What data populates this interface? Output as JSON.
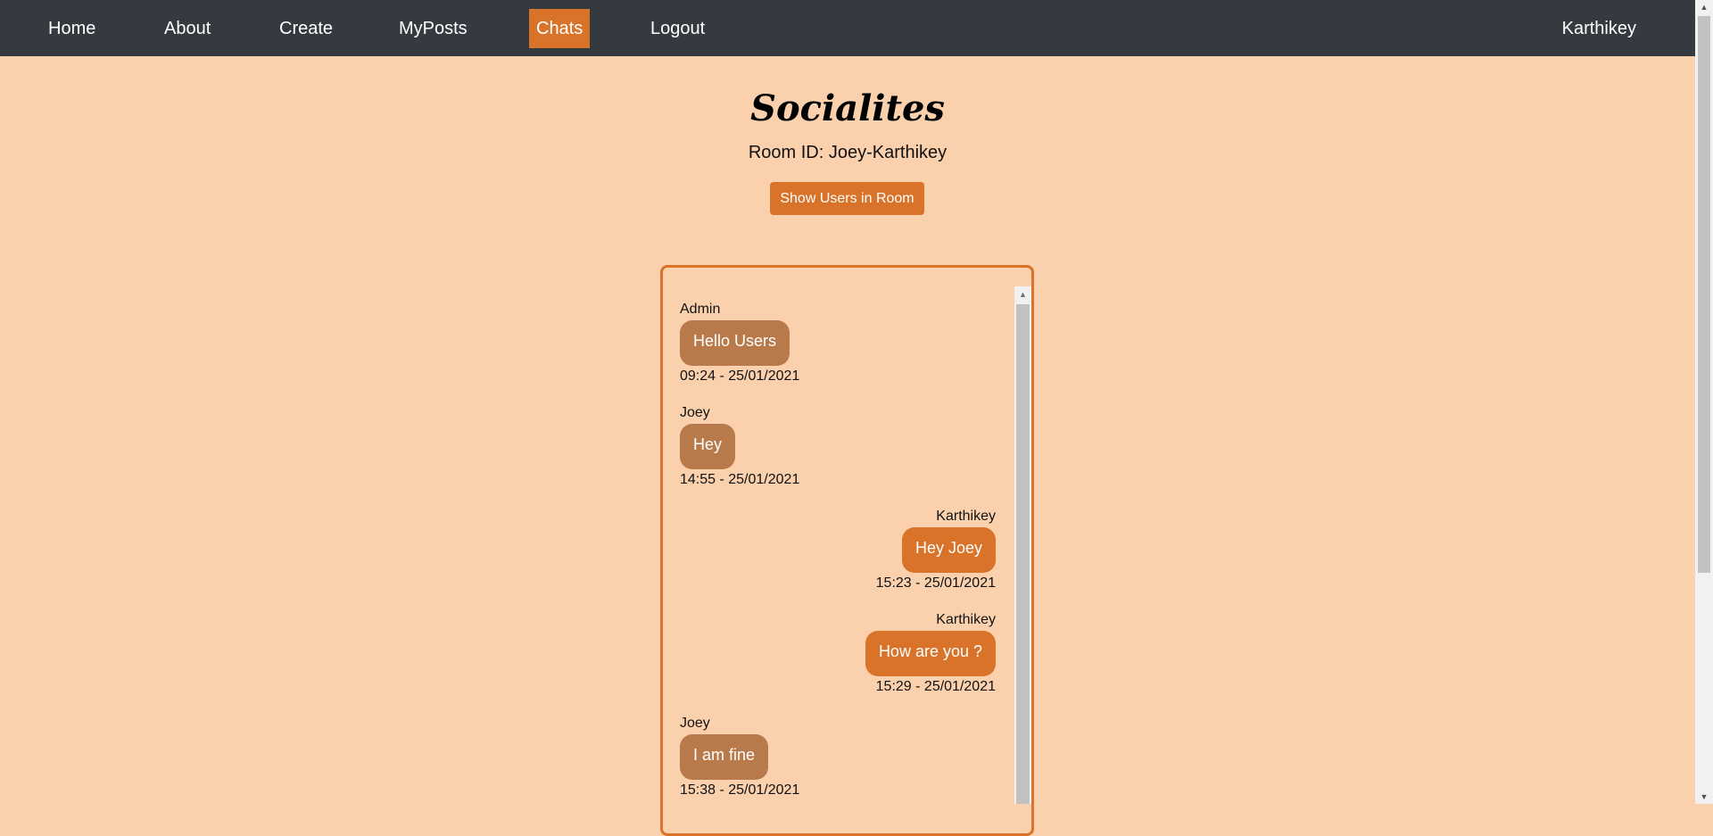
{
  "nav": {
    "home": "Home",
    "about": "About",
    "create": "Create",
    "myposts": "MyPosts",
    "chats": "Chats",
    "logout": "Logout",
    "user": "Karthikey"
  },
  "header": {
    "brand": "Socialites",
    "room_id": "Room ID: Joey-Karthikey",
    "show_users_label": "Show Users in Room"
  },
  "messages": [
    {
      "sender": "Admin",
      "text": "Hello Users",
      "time": "09:24 - 25/01/2021",
      "side": "received"
    },
    {
      "sender": "Joey",
      "text": "Hey",
      "time": "14:55 - 25/01/2021",
      "side": "received"
    },
    {
      "sender": "Karthikey",
      "text": "Hey Joey",
      "time": "15:23 - 25/01/2021",
      "side": "sent"
    },
    {
      "sender": "Karthikey",
      "text": "How are you ?",
      "time": "15:29 - 25/01/2021",
      "side": "sent"
    },
    {
      "sender": "Joey",
      "text": "I am fine",
      "time": "15:38 - 25/01/2021",
      "side": "received"
    }
  ],
  "colors": {
    "background": "#fad1ac",
    "navbar": "#343a40",
    "accent": "#d9732a",
    "received_bubble": "#b97a4b"
  }
}
